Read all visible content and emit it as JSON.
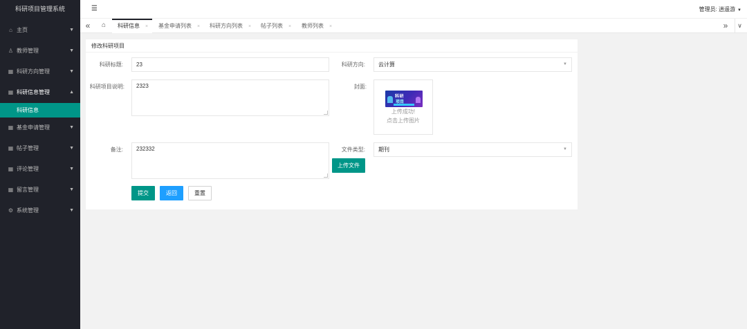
{
  "app": {
    "title": "科研项目管理系统"
  },
  "sidebar": {
    "items": [
      {
        "label": "主页",
        "icon": "home-icon",
        "glyph": "⌂",
        "arrow": "▼"
      },
      {
        "label": "教师管理",
        "icon": "user-icon",
        "glyph": "♙",
        "arrow": "▼"
      },
      {
        "label": "科研方向管理",
        "icon": "grid-icon",
        "glyph": "▦",
        "arrow": "▼"
      },
      {
        "label": "科研信息管理",
        "icon": "grid-icon",
        "glyph": "▦",
        "arrow": "▲"
      },
      {
        "label": "基金申请管理",
        "icon": "grid-icon",
        "glyph": "▦",
        "arrow": "▼"
      },
      {
        "label": "帖子管理",
        "icon": "grid-icon",
        "glyph": "▦",
        "arrow": "▼"
      },
      {
        "label": "评论管理",
        "icon": "grid-icon",
        "glyph": "▦",
        "arrow": "▼"
      },
      {
        "label": "留言管理",
        "icon": "grid-icon",
        "glyph": "▦",
        "arrow": "▼"
      },
      {
        "label": "系统管理",
        "icon": "gear-icon",
        "glyph": "⚙",
        "arrow": "▼"
      }
    ],
    "active_sub": "科研信息"
  },
  "header": {
    "menu_glyph": "☰",
    "admin_label": "管理员: 逍遥游",
    "caret": "▼"
  },
  "tabs": {
    "left_glyph": "«",
    "home_glyph": "⌂",
    "right_glyph": "»",
    "down_glyph": "∨",
    "close_glyph": "×",
    "items": [
      "科研信息",
      "基金申请列表",
      "科研方向列表",
      "帖子列表",
      "教师列表"
    ]
  },
  "form": {
    "title": "修改科研项目",
    "name_label": "科研标题:",
    "name_value": "23",
    "direction_label": "科研方向:",
    "direction_value": "云计算",
    "desc_label": "科研项目说明:",
    "desc_value": "2323",
    "cover_label": "封面:",
    "thumb_line1": "科研",
    "thumb_line2": "项目",
    "upload_hint1": "上传成功!",
    "upload_hint2": "点击上传图片",
    "remark_label": "备注:",
    "remark_value": "232332",
    "filetype_label": "文件类型:",
    "filetype_value": "期刊",
    "upload_file_btn": "上传文件",
    "submit_btn": "提交",
    "back_btn": "返回",
    "reset_btn": "重置",
    "select_caret": "▼"
  }
}
